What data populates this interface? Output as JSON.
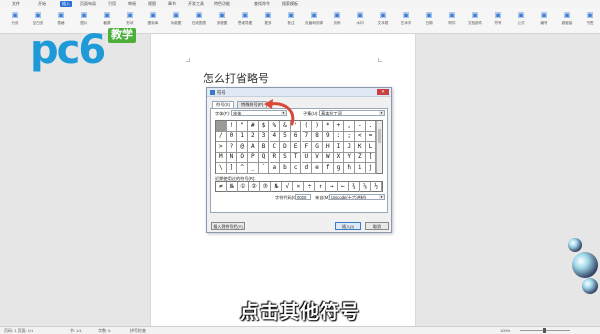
{
  "menubar": {
    "tabs": [
      "文件",
      "开始",
      "插入",
      "页面布局",
      "引用",
      "审阅",
      "视图",
      "章节",
      "开发工具",
      "特色功能",
      "查找命令",
      "搜索模板"
    ],
    "active_index": 2
  },
  "ribbon": {
    "buttons": [
      {
        "label": "分页",
        "icon": "page-break-icon"
      },
      {
        "label": "空白页",
        "icon": "blank-page-icon"
      },
      {
        "label": "表格",
        "icon": "table-icon"
      },
      {
        "label": "图片",
        "icon": "picture-icon"
      },
      {
        "label": "截屏",
        "icon": "screenshot-icon"
      },
      {
        "label": "形状",
        "icon": "shape-icon"
      },
      {
        "label": "图标库",
        "icon": "icon-library-icon"
      },
      {
        "label": "功能图",
        "icon": "chart-icon"
      },
      {
        "label": "在线图表",
        "icon": "online-chart-icon"
      },
      {
        "label": "流程图",
        "icon": "flowchart-icon"
      },
      {
        "label": "思维导图",
        "icon": "mindmap-icon"
      },
      {
        "label": "更多",
        "icon": "more-icon"
      },
      {
        "label": "批注",
        "icon": "comment-icon"
      },
      {
        "label": "页眉和页脚",
        "icon": "header-footer-icon"
      },
      {
        "label": "页码",
        "icon": "page-number-icon"
      },
      {
        "label": "水印",
        "icon": "watermark-icon"
      },
      {
        "label": "文本框",
        "icon": "textbox-icon"
      },
      {
        "label": "艺术字",
        "icon": "wordart-icon"
      },
      {
        "label": "日期",
        "icon": "date-icon"
      },
      {
        "label": "附件",
        "icon": "attachment-icon"
      },
      {
        "label": "文档部件",
        "icon": "doc-parts-icon"
      },
      {
        "label": "符号",
        "icon": "symbol-icon"
      },
      {
        "label": "公式",
        "icon": "formula-icon"
      },
      {
        "label": "编号",
        "icon": "numbering-icon"
      },
      {
        "label": "超链接",
        "icon": "hyperlink-icon"
      },
      {
        "label": "书签",
        "icon": "bookmark-icon"
      }
    ]
  },
  "logo": {
    "brand": "pc6",
    "badge": "教学"
  },
  "document": {
    "heading": "怎么打省略号"
  },
  "dialog": {
    "title": "符号",
    "close_glyph": "✕",
    "tabs": [
      "符号(S)",
      "特殊符号(P)"
    ],
    "font_label": "字体(F):",
    "font_value": "宋体",
    "subset_label": "子集(U):",
    "subset_value": "基本拉丁语",
    "symbols": [
      " ",
      "!",
      "\"",
      "#",
      "$",
      "%",
      "&",
      "'",
      "(",
      ")",
      "*",
      "+",
      ",",
      "-",
      ".",
      "/",
      "0",
      "1",
      "2",
      "3",
      "4",
      "5",
      "6",
      "7",
      "8",
      "9",
      ":",
      ";",
      "<",
      "=",
      ">",
      "?",
      "@",
      "A",
      "B",
      "C",
      "D",
      "E",
      "F",
      "G",
      "H",
      "I",
      "J",
      "K",
      "L",
      "M",
      "N",
      "O",
      "P",
      "Q",
      "R",
      "S",
      "T",
      "U",
      "V",
      "W",
      "X",
      "Y",
      "Z",
      "[",
      "\\",
      "]",
      "^",
      "_",
      "`",
      "a",
      "b",
      "c",
      "d",
      "e",
      "f",
      "g",
      "h",
      "i",
      "j"
    ],
    "recent_label": "近期使用过的符号(R):",
    "recent_symbols": [
      "≠",
      "№",
      "①",
      "②",
      "③",
      "№",
      "√",
      "×",
      "÷",
      "↑",
      "→",
      "←",
      "¾",
      "⅝",
      "½"
    ],
    "code_label": "字符代码(C):",
    "code_value": "0020",
    "from_label": "来自(M):",
    "from_value": "Unicode(十六进制)",
    "insert_to_symbol_bar": "插入到符号栏(Y)",
    "insert_button": "插入(I)",
    "cancel_button": "取消"
  },
  "subtitle": "点击其他符号",
  "statusbar": {
    "page": "页码: 1  页面: 1/1",
    "section": "节: 1/1",
    "words": "字数: 5",
    "spell": "拼写检查",
    "zoom": "100%"
  },
  "colors": {
    "accent": "#2b6fd6",
    "arrow": "#d94a3a",
    "logo_blue": "#1e9ad8",
    "logo_green": "#4caf3a"
  }
}
